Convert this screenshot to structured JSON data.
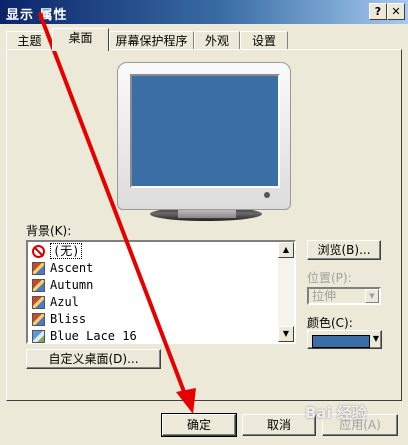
{
  "window": {
    "title": "显示 属性",
    "help_button": "?",
    "close_button": "X"
  },
  "tabs": [
    {
      "label": "主题",
      "active": false
    },
    {
      "label": "桌面",
      "active": true
    },
    {
      "label": "屏幕保护程序",
      "active": false
    },
    {
      "label": "外观",
      "active": false
    },
    {
      "label": "设置",
      "active": false
    }
  ],
  "background": {
    "label": "背景(K):",
    "items": [
      {
        "label": "(无)",
        "icon": "no-symbol-icon",
        "selected": true
      },
      {
        "label": "Ascent",
        "icon": "image-file-icon"
      },
      {
        "label": "Autumn",
        "icon": "image-file-icon"
      },
      {
        "label": "Azul",
        "icon": "image-file-icon"
      },
      {
        "label": "Bliss",
        "icon": "image-file-icon"
      },
      {
        "label": "Blue Lace 16",
        "icon": "bitmap-file-icon"
      }
    ]
  },
  "buttons": {
    "browse": "浏览(B)...",
    "customize": "自定义桌面(D)...",
    "ok": "确定",
    "cancel": "取消",
    "apply": "应用(A)"
  },
  "position": {
    "label": "位置(P):",
    "value": "拉伸"
  },
  "color": {
    "label": "颜色(C):",
    "value": "#3a6ea5"
  },
  "colors": {
    "titlebar_start": "#0a246a",
    "titlebar_end": "#a6caf0",
    "dialog_bg": "#ece9d8",
    "annotation_arrow": "#e60000"
  },
  "watermark": "Bai 经验"
}
